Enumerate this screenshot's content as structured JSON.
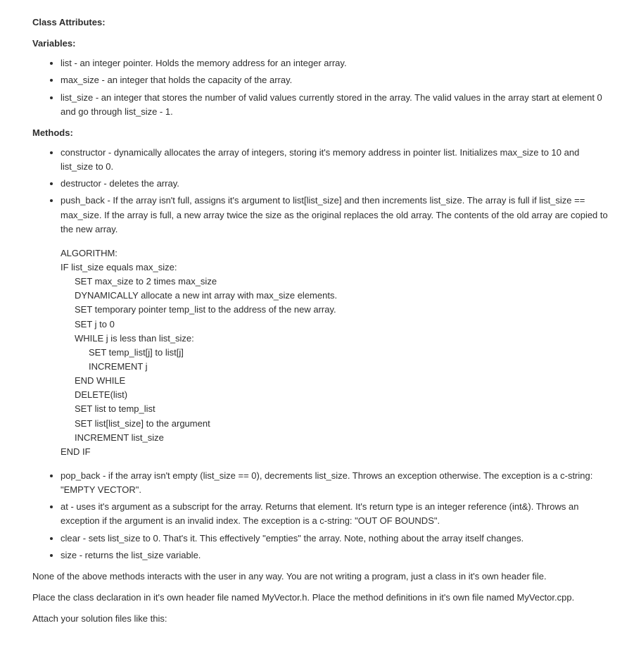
{
  "headings": {
    "class_attributes": "Class Attributes:",
    "variables": "Variables:",
    "methods": "Methods:"
  },
  "variables": [
    "list - an integer pointer.  Holds the memory address for an integer array.",
    "max_size - an integer that holds the capacity of the array.",
    "list_size - an integer that stores the number of valid values currently stored in the array.  The valid values in the array start at element 0 and go through list_size - 1."
  ],
  "methods_top": [
    "constructor - dynamically allocates the array of integers, storing it's memory address in pointer list.  Initializes max_size to 10 and list_size to 0.",
    "destructor - deletes the array."
  ],
  "push_back_text": "push_back - If the array isn't full, assigns it's argument to list[list_size] and then increments list_size.  The array is full if list_size == max_size.  If the array is full, a new array twice the size as the original replaces the old array.  The contents of the old array are copied to the new array.",
  "algorithm_label": "ALGORITHM:",
  "algorithm_lines": [
    {
      "indent": 0,
      "text": "IF list_size equals max_size:"
    },
    {
      "indent": 1,
      "text": "SET max_size to 2 times max_size"
    },
    {
      "indent": 1,
      "text": "DYNAMICALLY allocate a new int array with max_size elements."
    },
    {
      "indent": 1,
      "text": "SET temporary pointer temp_list to the address of the new array."
    },
    {
      "indent": 1,
      "text": "SET j to 0"
    },
    {
      "indent": 1,
      "text": "WHILE j is less than list_size:"
    },
    {
      "indent": 2,
      "text": "SET temp_list[j] to list[j]"
    },
    {
      "indent": 2,
      "text": "INCREMENT j"
    },
    {
      "indent": 1,
      "text": "END WHILE"
    },
    {
      "indent": 1,
      "text": "DELETE(list)"
    },
    {
      "indent": 1,
      "text": "SET list to temp_list"
    },
    {
      "indent": 1,
      "text": "SET list[list_size] to the argument"
    },
    {
      "indent": 1,
      "text": "INCREMENT list_size"
    },
    {
      "indent": 0,
      "text": "END IF"
    }
  ],
  "methods_bottom": [
    "pop_back - if the array isn't empty (list_size == 0), decrements list_size.  Throws an exception otherwise.  The exception is a c-string: \"EMPTY VECTOR\".",
    "at - uses it's argument as a subscript for the array.  Returns that element.  It's return type is an integer reference (int&).  Throws an exception if the argument is an invalid index.  The exception is a c-string:  \"OUT OF BOUNDS\".",
    "clear - sets list_size to 0.  That's it.  This effectively \"empties\" the array.  Note, nothing about the array itself changes.",
    "size - returns the list_size variable."
  ],
  "footer": {
    "p1": "None of the above methods interacts with the user in any way.  You are not writing a program, just a class in it's own header file.",
    "p2": "Place the class declaration in it's own header file named MyVector.h.  Place the method definitions in it's own file named MyVector.cpp.",
    "p3": "Attach your solution files like this:"
  }
}
